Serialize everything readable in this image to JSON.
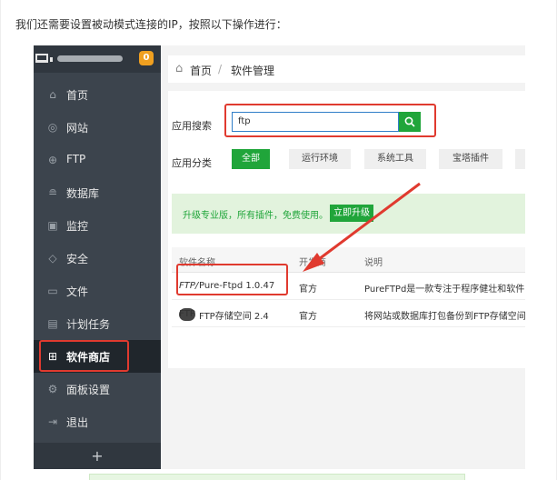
{
  "intro": "我们还需要设置被动模式连接的IP，按照以下操作进行：",
  "sidebar": {
    "badge": "0",
    "items": [
      {
        "label": "首页",
        "icon": "home-icon"
      },
      {
        "label": "网站",
        "icon": "globe-icon"
      },
      {
        "label": "FTP",
        "icon": "ftp-icon"
      },
      {
        "label": "数据库",
        "icon": "database-icon"
      },
      {
        "label": "监控",
        "icon": "monitor-icon"
      },
      {
        "label": "安全",
        "icon": "shield-icon"
      },
      {
        "label": "文件",
        "icon": "folder-icon"
      },
      {
        "label": "计划任务",
        "icon": "calendar-icon"
      },
      {
        "label": "软件商店",
        "icon": "grid-icon"
      },
      {
        "label": "面板设置",
        "icon": "gear-icon"
      },
      {
        "label": "退出",
        "icon": "logout-icon"
      }
    ],
    "plus": "+"
  },
  "breadcrumb": {
    "home": "首页",
    "sep": "/",
    "current": "软件管理"
  },
  "search": {
    "label": "应用搜索",
    "value": "ftp"
  },
  "category": {
    "label": "应用分类",
    "buttons": [
      "全部",
      "运行环境",
      "系统工具",
      "宝塔插件"
    ]
  },
  "promo": {
    "text": "升级专业版，所有插件，免费使用。",
    "button": "立即升级"
  },
  "table": {
    "headers": [
      "软件名称",
      "开发商",
      "说明"
    ],
    "rows": [
      {
        "logo": "FTP/",
        "name": "Pure-Ftpd 1.0.47",
        "vendor": "官方",
        "desc": "PureFTPd是一款专注于程序健壮和软件"
      },
      {
        "logo": "FTP",
        "name": "FTP存储空间 2.4",
        "vendor": "官方",
        "desc": "将网站或数据库打包备份到FTP存储空间"
      }
    ]
  },
  "colors": {
    "accent": "#20a53a",
    "highlight": "#e03a2f",
    "sidebar": "#3c444d"
  }
}
